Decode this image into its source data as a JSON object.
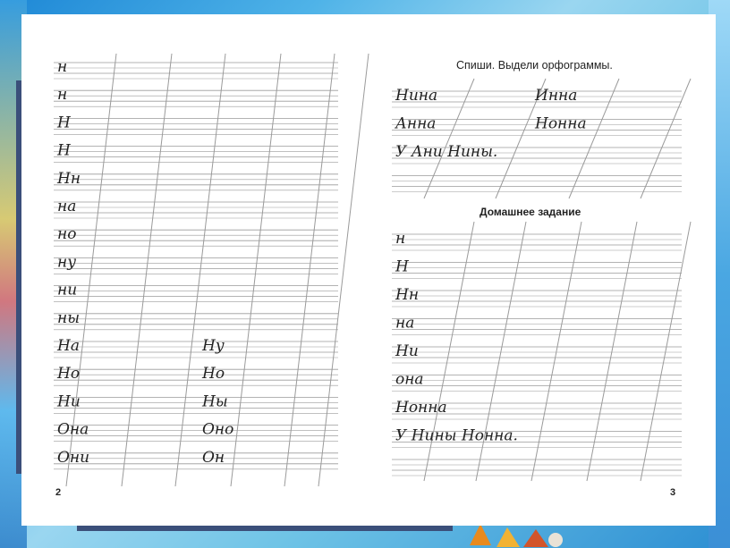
{
  "left_page": {
    "page_number": "2",
    "rows": [
      {
        "a": "н",
        "b": ""
      },
      {
        "a": "н",
        "b": ""
      },
      {
        "a": "Н",
        "b": ""
      },
      {
        "a": "Н",
        "b": ""
      },
      {
        "a": "Нн",
        "b": ""
      },
      {
        "a": "на",
        "b": ""
      },
      {
        "a": "но",
        "b": ""
      },
      {
        "a": "ну",
        "b": ""
      },
      {
        "a": "ни",
        "b": ""
      },
      {
        "a": "ны",
        "b": ""
      },
      {
        "a": "На",
        "b": "Ну"
      },
      {
        "a": "Но",
        "b": "Но"
      },
      {
        "a": "Ни",
        "b": "Ны"
      },
      {
        "a": "Она",
        "b": "Оно"
      },
      {
        "a": "Они",
        "b": "Он"
      }
    ]
  },
  "right_page": {
    "page_number": "3",
    "task1": {
      "title": "Спиши. Выдели орфограммы.",
      "rows": [
        {
          "a": "Нина",
          "b": "Инна"
        },
        {
          "a": "Анна",
          "b": "Нонна"
        },
        {
          "a": "У Ани Нины.",
          "b": ""
        },
        {
          "a": "",
          "b": ""
        }
      ]
    },
    "task2": {
      "title": "Домашнее задание",
      "rows": [
        {
          "a": "н",
          "b": ""
        },
        {
          "a": "Н",
          "b": ""
        },
        {
          "a": "Нн",
          "b": ""
        },
        {
          "a": "на",
          "b": ""
        },
        {
          "a": "Ни",
          "b": ""
        },
        {
          "a": "она",
          "b": ""
        },
        {
          "a": "Нонна",
          "b": ""
        },
        {
          "a": "У Нины Нонна.",
          "b": ""
        },
        {
          "a": "",
          "b": ""
        }
      ]
    }
  },
  "colors": {
    "ruling": "#9a9a9a",
    "ink": "#222222",
    "page": "#ffffff"
  }
}
